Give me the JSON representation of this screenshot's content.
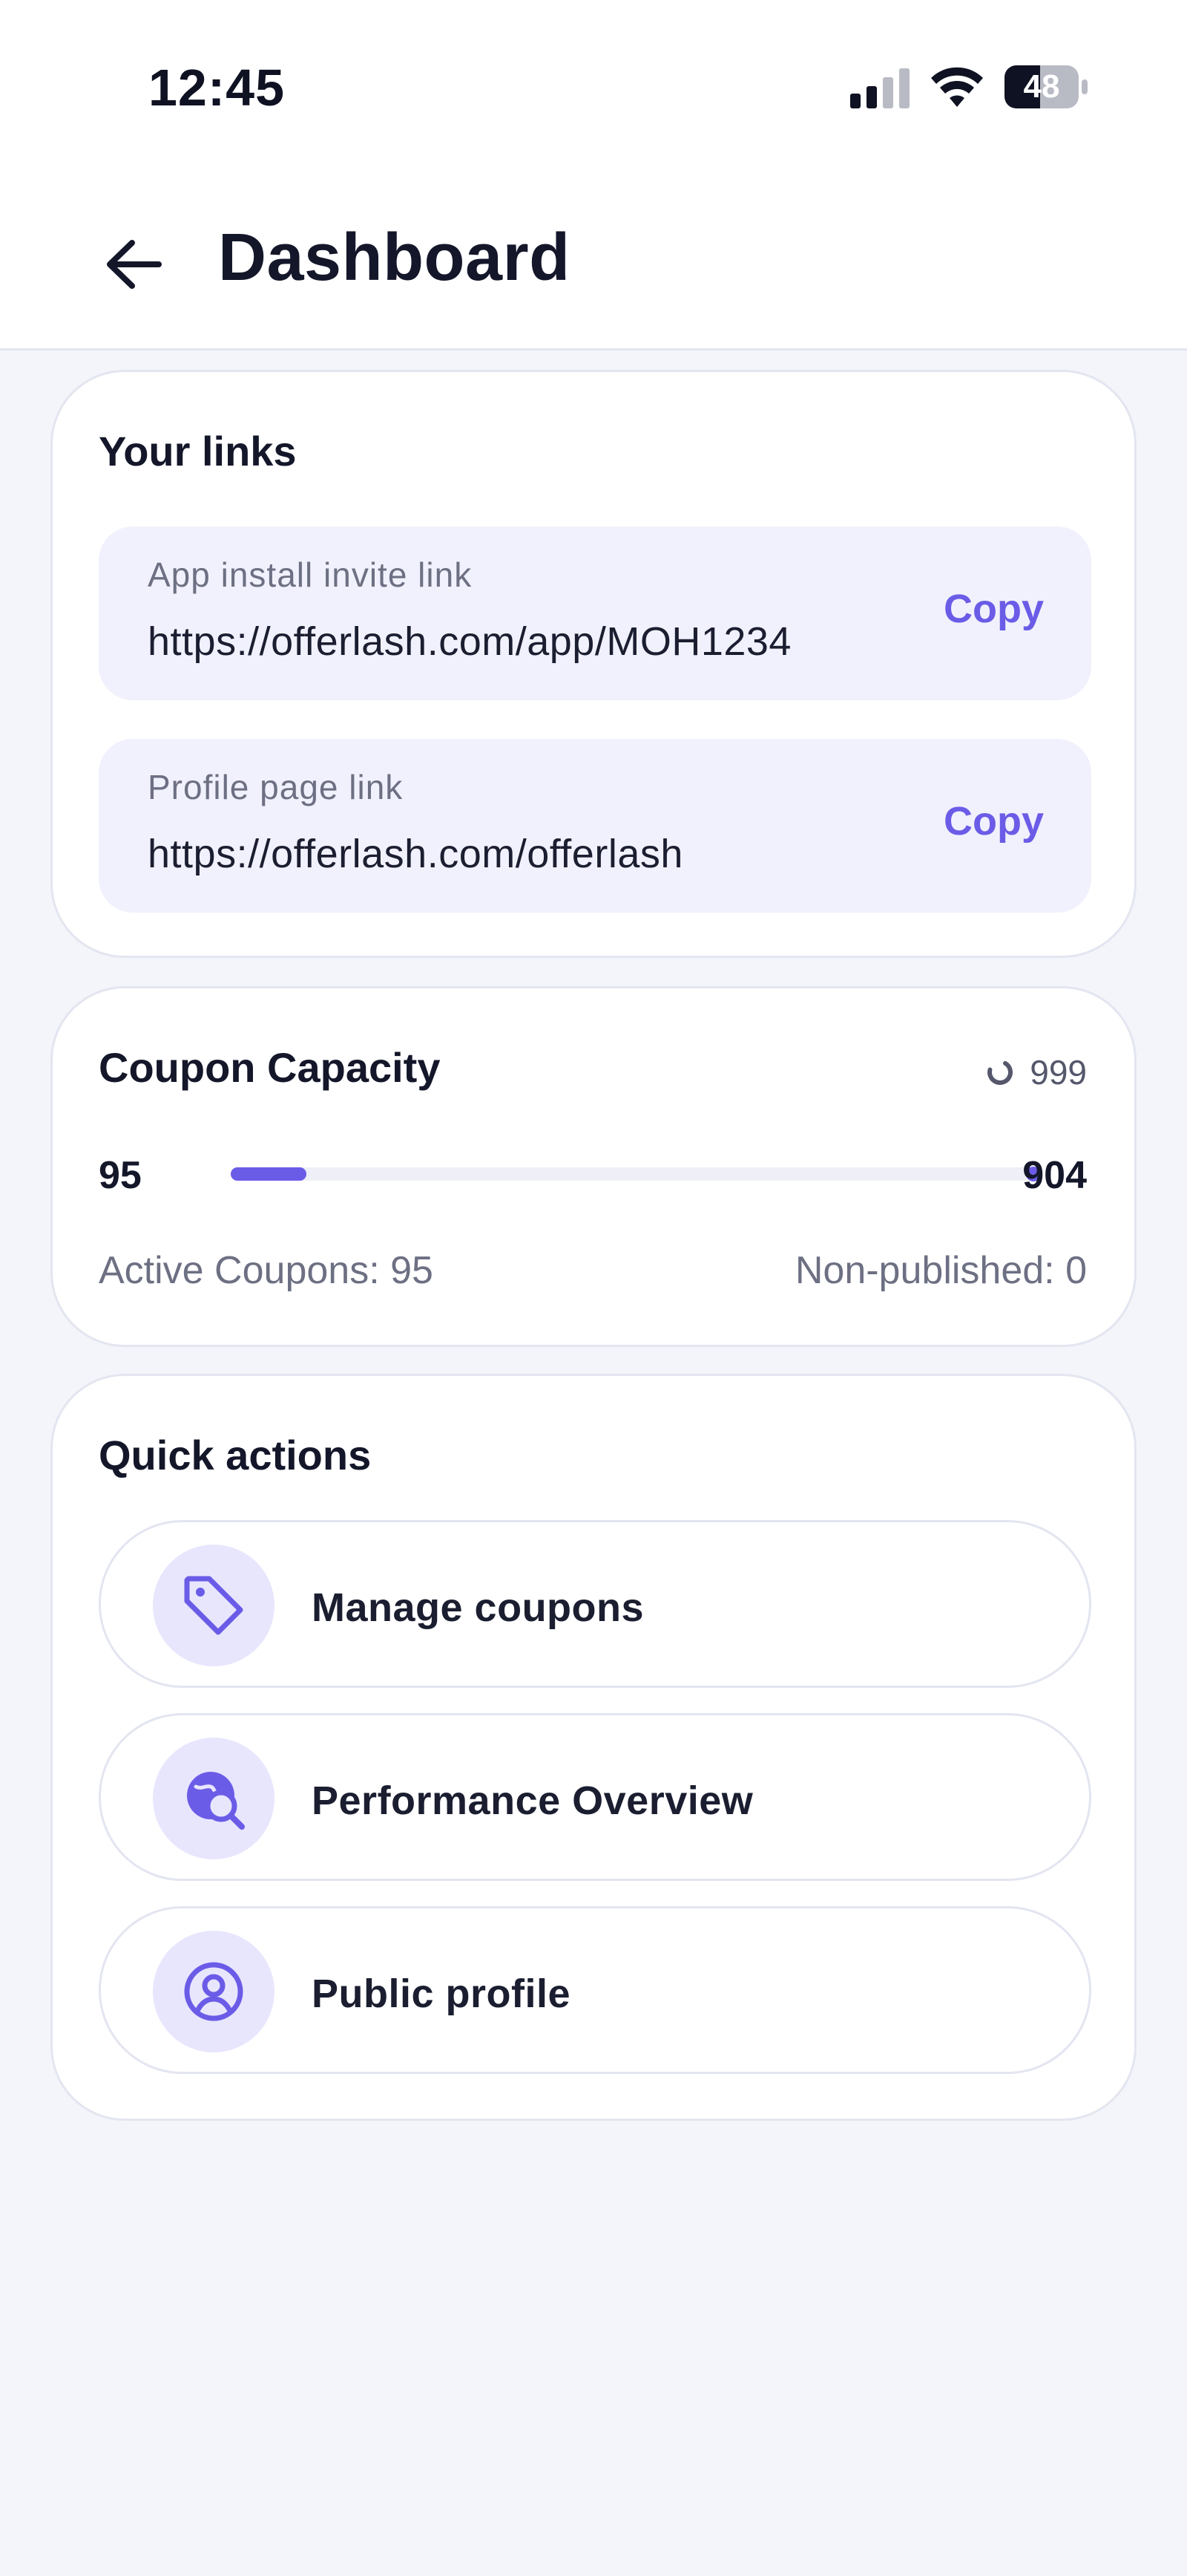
{
  "status_bar": {
    "time": "12:45",
    "battery": "48",
    "icons": [
      "cellular-signal-icon",
      "wifi-icon",
      "battery-icon"
    ]
  },
  "header": {
    "title": "Dashboard",
    "back_icon": "arrow-left-icon"
  },
  "links": {
    "title": "Your links",
    "items": [
      {
        "label": "App install invite link",
        "url": "https://offerlash.com/app/MOH1234",
        "action": "Copy"
      },
      {
        "label": "Profile page link",
        "url": "https://offerlash.com/offerlash",
        "action": "Copy"
      }
    ]
  },
  "capacity": {
    "title": "Coupon Capacity",
    "total": "999",
    "used": "95",
    "remaining": "904",
    "used_fraction": 0.095,
    "active_text": "Active Coupons: 95",
    "nonpublished_text": "Non-published: 0"
  },
  "quick_actions": {
    "title": "Quick actions",
    "items": [
      {
        "label": "Manage coupons",
        "icon": "tag-icon"
      },
      {
        "label": "Performance Overview",
        "icon": "globe-search-icon"
      },
      {
        "label": "Public profile",
        "icon": "user-circle-icon"
      }
    ]
  },
  "colors": {
    "accent": "#6b5ce7",
    "accent_soft": "#e8e6fd",
    "background": "#f4f5fa",
    "link_box": "#f1f1fd"
  }
}
